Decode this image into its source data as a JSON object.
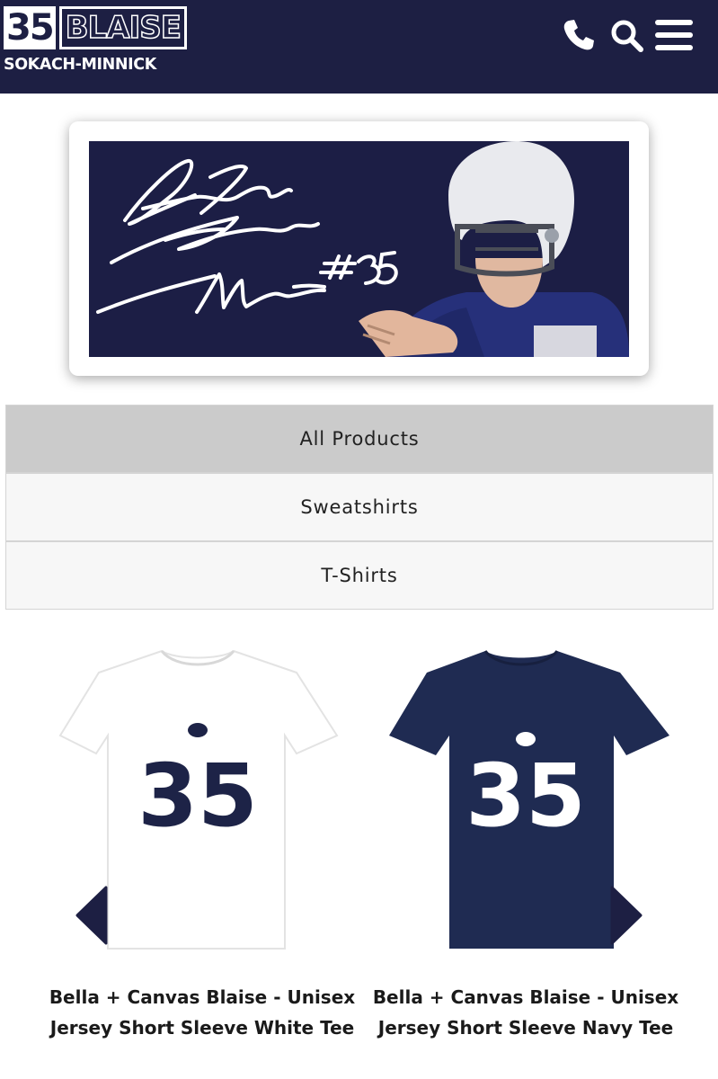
{
  "header": {
    "logo_number": "35",
    "logo_name": "BLAISE",
    "logo_surname": "SOKACH-MINNICK",
    "icons": [
      "phone-icon",
      "search-icon",
      "menu-icon"
    ],
    "background_color": "#1d1f43"
  },
  "banner": {
    "signature_text": "Blaise Sokach-Minnick #35",
    "background_color": "#1c1e45"
  },
  "categories": [
    {
      "label": "All Products",
      "active": true
    },
    {
      "label": "Sweatshirts",
      "active": false
    },
    {
      "label": "T-Shirts",
      "active": false
    }
  ],
  "products": [
    {
      "title": "Bella + Canvas Blaise - Unisex Jersey Short Sleeve White Tee",
      "shirt_color": "#ffffff",
      "number": "35",
      "number_color": "#1d2347"
    },
    {
      "title": "Bella + Canvas Blaise - Unisex Jersey Short Sleeve Navy Tee",
      "shirt_color": "#1f2b52",
      "number": "35",
      "number_color": "#ffffff"
    }
  ],
  "carousel": {
    "prev_icon": "chevron-left-icon",
    "next_icon": "chevron-right-icon",
    "arrow_color": "#1d1f43"
  }
}
